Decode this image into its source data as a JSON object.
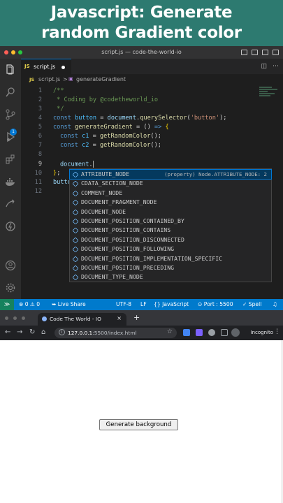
{
  "banner": {
    "line1": "Javascript: Generate",
    "line2": "random Gradient color"
  },
  "vscode": {
    "window_title": "script.js — code-the-world-io",
    "tab": {
      "lang": "JS",
      "label": "script.js"
    },
    "breadcrumb": {
      "file": "script.js",
      "separator": ">",
      "symbol": "generateGradient"
    },
    "explorer_badge": "1",
    "line_numbers": [
      "1",
      "2",
      "3",
      "4",
      "5",
      "6",
      "7",
      "8",
      "9",
      "10",
      "11",
      "12"
    ],
    "code": {
      "l1": "/**",
      "l2": " * Coding by @codetheworld_io",
      "l3": " */",
      "l4_kw": "const",
      "l4_var": "button",
      "l4_eq": " = ",
      "l4_obj": "document",
      "l4_dot": ".",
      "l4_fn": "querySelector",
      "l4_open": "(",
      "l4_str": "'button'",
      "l4_close": ");",
      "l5_kw": "const",
      "l5_fn": "generateGradient",
      "l5_eq": " = ",
      "l5_paren": "()",
      "l5_arrow": " => ",
      "l5_brace": "{",
      "l6_kw": "const",
      "l6_var": "c1",
      "l6_eq": " = ",
      "l6_fn": "getRandomColor",
      "l6_end": "();",
      "l7_kw": "const",
      "l7_var": "c2",
      "l7_eq": " = ",
      "l7_fn": "getRandomColor",
      "l7_end": "();",
      "l9_obj": "document",
      "l9_dot": ".",
      "l10_brace": "}",
      "l10_rest": ";",
      "l11": "butto"
    },
    "suggestions": [
      {
        "hl": "",
        "label": "ATTRIBUTE_NODE",
        "detail": "(property) Node.ATTRIBUTE_NODE: 2"
      },
      {
        "hl": "",
        "label": "CDATA_SECTION_NODE",
        "detail": ""
      },
      {
        "hl": "",
        "label": "COMMENT_NODE",
        "detail": ""
      },
      {
        "hl": "",
        "label": "DOCUMENT_FRAGMENT_NODE",
        "detail": ""
      },
      {
        "hl": "",
        "label": "DOCUMENT_NODE",
        "detail": ""
      },
      {
        "hl": "",
        "label": "DOCUMENT_POSITION_CONTAINED_BY",
        "detail": ""
      },
      {
        "hl": "",
        "label": "DOCUMENT_POSITION_CONTAINS",
        "detail": ""
      },
      {
        "hl": "",
        "label": "DOCUMENT_POSITION_DISCONNECTED",
        "detail": ""
      },
      {
        "hl": "",
        "label": "DOCUMENT_POSITION_FOLLOWING",
        "detail": ""
      },
      {
        "hl": "",
        "label": "DOCUMENT_POSITION_IMPLEMENTATION_SPECIFIC",
        "detail": ""
      },
      {
        "hl": "",
        "label": "DOCUMENT_POSITION_PRECEDING",
        "detail": ""
      },
      {
        "hl": "",
        "label": "DOCUMENT_TYPE_NODE",
        "detail": ""
      }
    ],
    "status": {
      "errors": "0",
      "warnings": "0",
      "live_share": "Live Share",
      "encoding": "UTF-8",
      "eol": "LF",
      "language": "JavaScript",
      "port": "Port : 5500",
      "spell": "Spell"
    }
  },
  "browser": {
    "tab_title": "Code The World - IO",
    "tab_close": "×",
    "new_tab": "+",
    "url_host": "127.0.0.1",
    "url_path": ":5500/index.html",
    "incognito": "Incognito",
    "page_button": "Generate background"
  },
  "colors": {
    "banner": "#2d7a70",
    "statusbar": "#007acc",
    "accent": "#0078d4"
  }
}
